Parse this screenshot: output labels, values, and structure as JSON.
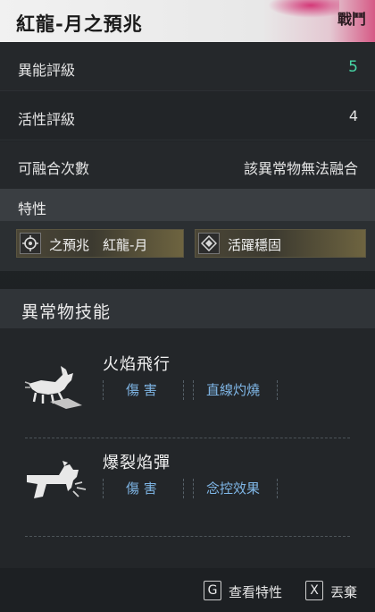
{
  "header": {
    "title": "紅龍-月之預兆",
    "badge": "戰鬥"
  },
  "stats": [
    {
      "label": "異能評級",
      "value": "5"
    },
    {
      "label": "活性評級",
      "value": "4"
    },
    {
      "label": "可融合次數",
      "value": "該異常物無法融合"
    }
  ],
  "traits": {
    "header": "特性",
    "items": [
      {
        "label": "之預兆　紅龍-月",
        "icon": "crosshair-icon"
      },
      {
        "label": "活躍穩固",
        "icon": "diamond-icon"
      }
    ]
  },
  "skills": {
    "header": "異常物技能",
    "items": [
      {
        "name": "火焰飛行",
        "icon": "goat-creature-icon",
        "tags": [
          "傷 害",
          "直線灼燒"
        ]
      },
      {
        "name": "爆裂焰彈",
        "icon": "goat-gun-icon",
        "tags": [
          "傷 害",
          "念控效果"
        ]
      }
    ]
  },
  "footer": {
    "hints": [
      {
        "key": "G",
        "label": "查看特性"
      },
      {
        "key": "X",
        "label": "丟棄"
      }
    ]
  },
  "colors": {
    "accent": "#47d6a6",
    "tag": "#7fb6e6",
    "header_splash": "#d65a86",
    "chip_gold": "#6e6440"
  }
}
